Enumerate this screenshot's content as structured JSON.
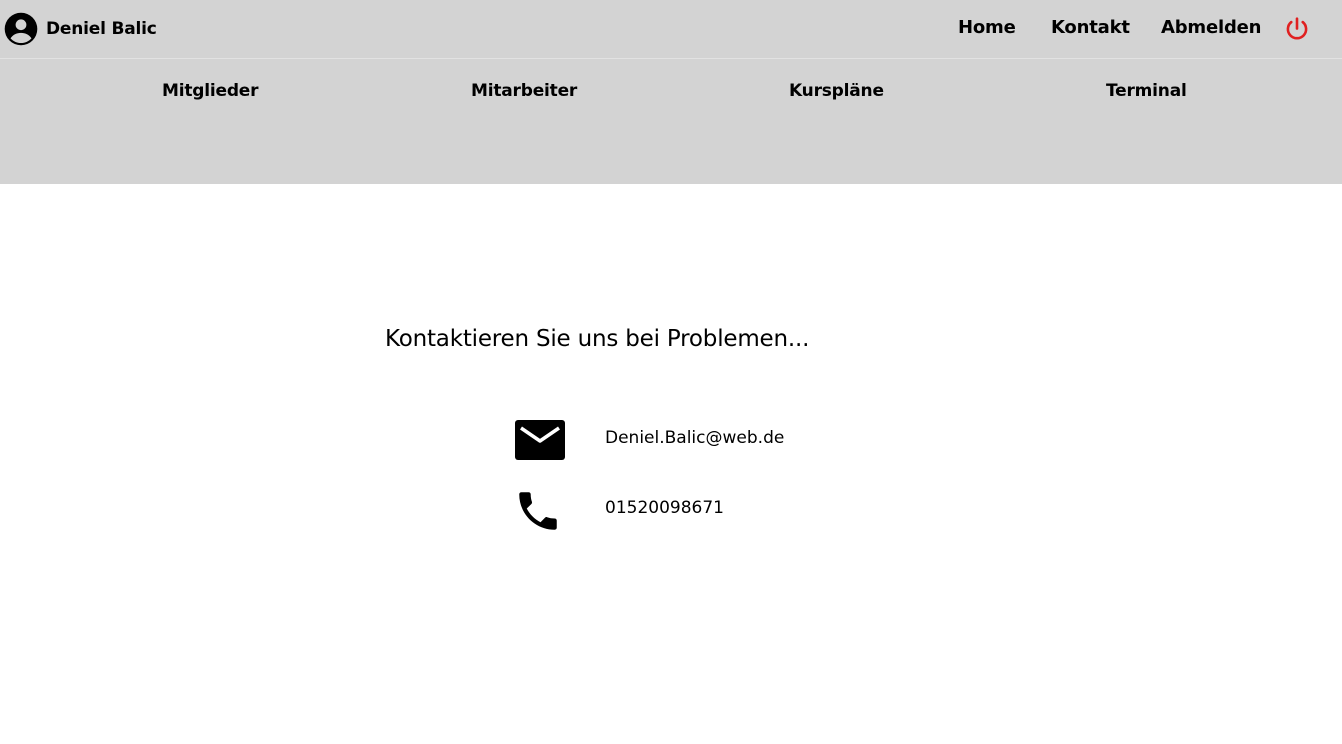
{
  "header": {
    "user_name": "Deniel Balic",
    "nav": {
      "home": "Home",
      "kontakt": "Kontakt",
      "abmelden": "Abmelden"
    },
    "icons": {
      "avatar": "account-circle-icon",
      "power": "power-icon"
    },
    "colors": {
      "bar": "#d3d3d3",
      "power": "#e02020"
    }
  },
  "subnav": {
    "items": [
      "Mitglieder",
      "Mitarbeiter",
      "Kurspläne",
      "Terminal"
    ]
  },
  "main": {
    "heading": "Kontaktieren Sie uns bei Problemen...",
    "contacts": {
      "email": "Deniel.Balic@web.de",
      "phone": "01520098671"
    },
    "icons": {
      "email": "mail-icon",
      "phone": "phone-icon"
    }
  }
}
